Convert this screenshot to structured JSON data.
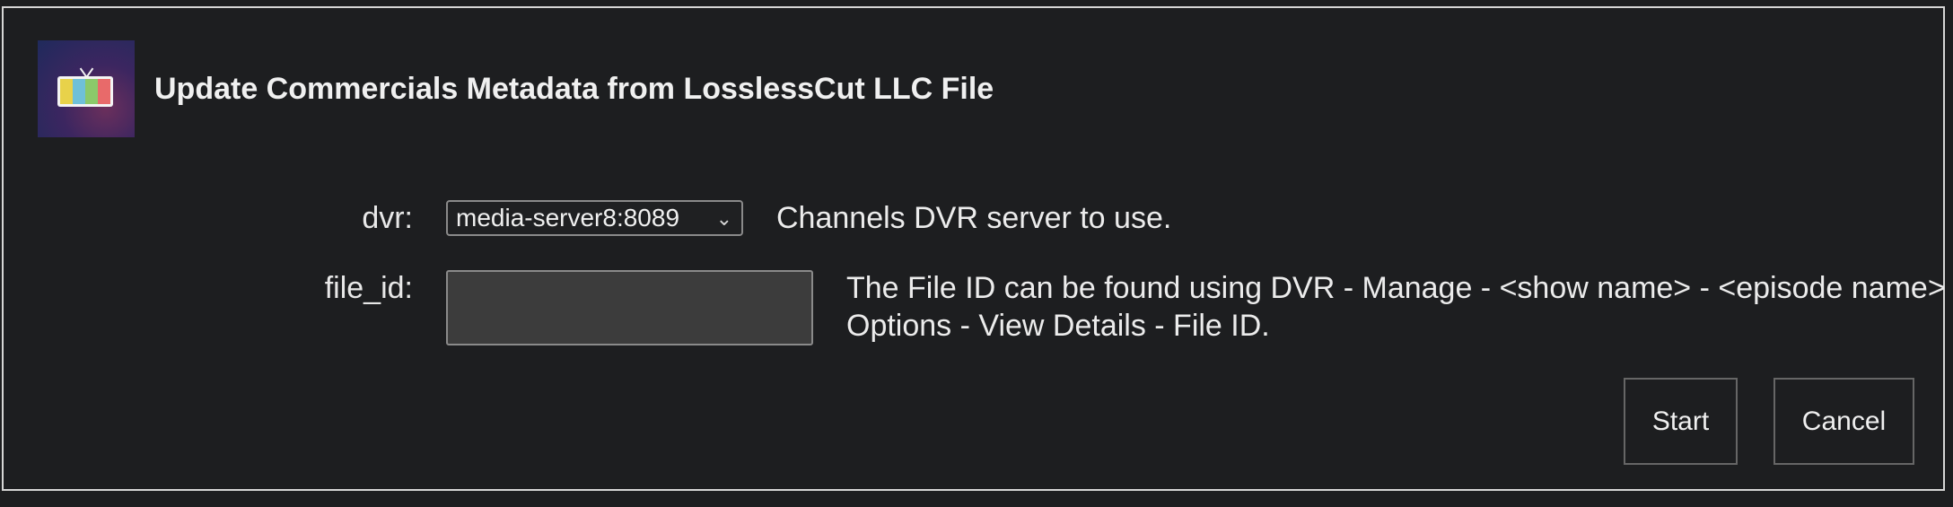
{
  "dialog": {
    "title": "Update Commercials Metadata from LosslessCut LLC File",
    "icon": "tv-icon"
  },
  "fields": {
    "dvr": {
      "label": "dvr:",
      "selected": "media-server8:8089",
      "help": "Channels DVR server to use."
    },
    "file_id": {
      "label": "file_id:",
      "value": "",
      "help": "The File ID can be found using DVR - Manage - <show name> - <episode name> - Options - View Details - File ID."
    }
  },
  "buttons": {
    "start": "Start",
    "cancel": "Cancel"
  },
  "colors": {
    "background": "#1d1e20",
    "border": "#d6d6d6",
    "input_bg": "#3c3c3c"
  }
}
